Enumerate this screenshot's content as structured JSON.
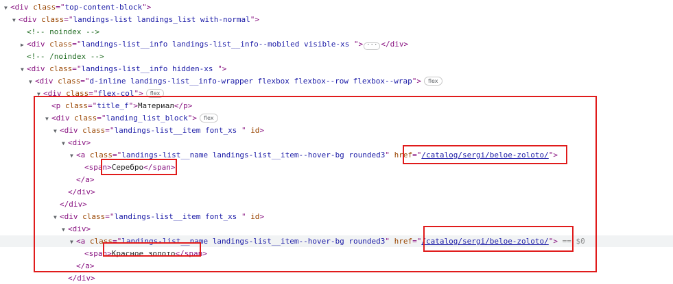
{
  "colors": {
    "tag": "#881280",
    "attr_name": "#994500",
    "attr_value": "#1a1aa6",
    "comment": "#236e25",
    "highlight": "#e01b1b"
  },
  "lines": [
    {
      "tri": "open",
      "parts": [
        {
          "t": "tag",
          "v": "<div "
        },
        {
          "t": "an",
          "v": "class"
        },
        {
          "t": "tag",
          "v": "=\""
        },
        {
          "t": "av",
          "v": "top-content-block"
        },
        {
          "t": "tag",
          "v": "\">"
        }
      ]
    },
    {
      "tri": "open",
      "parts": [
        {
          "t": "tag",
          "v": "<div "
        },
        {
          "t": "an",
          "v": "class"
        },
        {
          "t": "tag",
          "v": "=\""
        },
        {
          "t": "av",
          "v": "landings-list landings_list with-normal"
        },
        {
          "t": "tag",
          "v": "\">"
        }
      ]
    },
    {
      "tri": "none",
      "parts": [
        {
          "t": "cm",
          "v": "<!-- noindex -->"
        }
      ]
    },
    {
      "tri": "closed",
      "parts": [
        {
          "t": "tag",
          "v": "<div "
        },
        {
          "t": "an",
          "v": "class"
        },
        {
          "t": "tag",
          "v": "=\""
        },
        {
          "t": "av",
          "v": "landings-list__info landings-list__info--mobiled visible-xs "
        },
        {
          "t": "tag",
          "v": "\">"
        },
        {
          "t": "ell",
          "v": "···"
        },
        {
          "t": "tag",
          "v": "</div>"
        }
      ]
    },
    {
      "tri": "none",
      "parts": [
        {
          "t": "cm",
          "v": "<!-- /noindex -->"
        }
      ]
    },
    {
      "tri": "open",
      "parts": [
        {
          "t": "tag",
          "v": "<div "
        },
        {
          "t": "an",
          "v": "class"
        },
        {
          "t": "tag",
          "v": "=\""
        },
        {
          "t": "av",
          "v": "landings-list__info hidden-xs "
        },
        {
          "t": "tag",
          "v": "\">"
        }
      ]
    },
    {
      "tri": "open",
      "parts": [
        {
          "t": "tag",
          "v": "<div "
        },
        {
          "t": "an",
          "v": "class"
        },
        {
          "t": "tag",
          "v": "=\""
        },
        {
          "t": "av",
          "v": "d-inline landings-list__info-wrapper  flexbox flexbox--row flexbox--wrap"
        },
        {
          "t": "tag",
          "v": "\">"
        },
        {
          "t": "pill",
          "v": "flex"
        }
      ]
    },
    {
      "tri": "open",
      "parts": [
        {
          "t": "tag",
          "v": "<div "
        },
        {
          "t": "an",
          "v": "class"
        },
        {
          "t": "tag",
          "v": "=\""
        },
        {
          "t": "av",
          "v": "flex-col"
        },
        {
          "t": "tag",
          "v": "\">"
        },
        {
          "t": "pill",
          "v": "flex"
        }
      ]
    },
    {
      "tri": "none",
      "parts": [
        {
          "t": "tag",
          "v": "<p "
        },
        {
          "t": "an",
          "v": "class"
        },
        {
          "t": "tag",
          "v": "=\""
        },
        {
          "t": "av",
          "v": "title_f"
        },
        {
          "t": "tag",
          "v": "\">"
        },
        {
          "t": "txt",
          "v": "Материал"
        },
        {
          "t": "tag",
          "v": "</p>"
        }
      ]
    },
    {
      "tri": "open",
      "parts": [
        {
          "t": "tag",
          "v": "<div "
        },
        {
          "t": "an",
          "v": "class"
        },
        {
          "t": "tag",
          "v": "=\""
        },
        {
          "t": "av",
          "v": "landing_list_block"
        },
        {
          "t": "tag",
          "v": "\">"
        },
        {
          "t": "pill",
          "v": "flex"
        }
      ]
    },
    {
      "tri": "open",
      "parts": [
        {
          "t": "tag",
          "v": "<div "
        },
        {
          "t": "an",
          "v": "class"
        },
        {
          "t": "tag",
          "v": "=\""
        },
        {
          "t": "av",
          "v": "landings-list__item font_xs  "
        },
        {
          "t": "tag",
          "v": "\" "
        },
        {
          "t": "an",
          "v": "id"
        },
        {
          "t": "tag",
          "v": ">"
        }
      ]
    },
    {
      "tri": "open",
      "parts": [
        {
          "t": "tag",
          "v": "<div>"
        }
      ]
    },
    {
      "tri": "open",
      "parts": [
        {
          "t": "tag",
          "v": "<a "
        },
        {
          "t": "an",
          "v": "class"
        },
        {
          "t": "tag",
          "v": "=\""
        },
        {
          "t": "av",
          "v": "landings-list__name landings-list__item--hover-bg rounded3"
        },
        {
          "t": "tag",
          "v": "\" "
        },
        {
          "t": "an",
          "v": "href"
        },
        {
          "t": "tag",
          "v": "=\""
        },
        {
          "t": "avl",
          "v": "/catalog/sergi/beloe-zoloto/"
        },
        {
          "t": "tag",
          "v": "\">"
        }
      ]
    },
    {
      "tri": "none",
      "parts": [
        {
          "t": "tag",
          "v": "<span>"
        },
        {
          "t": "txt",
          "v": "Серебро"
        },
        {
          "t": "tag",
          "v": "</span>"
        }
      ]
    },
    {
      "tri": "none",
      "parts": [
        {
          "t": "tag",
          "v": "</a>"
        }
      ]
    },
    {
      "tri": "none",
      "parts": [
        {
          "t": "tag",
          "v": "</div>"
        }
      ]
    },
    {
      "tri": "none",
      "parts": [
        {
          "t": "tag",
          "v": "</div>"
        }
      ]
    },
    {
      "tri": "open",
      "parts": [
        {
          "t": "tag",
          "v": "<div "
        },
        {
          "t": "an",
          "v": "class"
        },
        {
          "t": "tag",
          "v": "=\""
        },
        {
          "t": "av",
          "v": "landings-list__item font_xs  "
        },
        {
          "t": "tag",
          "v": "\" "
        },
        {
          "t": "an",
          "v": "id"
        },
        {
          "t": "tag",
          "v": ">"
        }
      ]
    },
    {
      "tri": "open",
      "parts": [
        {
          "t": "tag",
          "v": "<div>"
        }
      ]
    },
    {
      "tri": "open",
      "parts": [
        {
          "t": "tag",
          "v": "<a "
        },
        {
          "t": "an",
          "v": "class"
        },
        {
          "t": "tag",
          "v": "=\""
        },
        {
          "t": "av",
          "v": "landings-list__name landings-list__item--hover-bg rounded3"
        },
        {
          "t": "tag",
          "v": "\" "
        },
        {
          "t": "an",
          "v": "href"
        },
        {
          "t": "tag",
          "v": "=\""
        },
        {
          "t": "avl",
          "v": "/catalog/sergi/beloe-zoloto/"
        },
        {
          "t": "tag",
          "v": "\">"
        },
        {
          "t": "mk",
          "v": " == $0"
        }
      ]
    },
    {
      "tri": "none",
      "parts": [
        {
          "t": "tag",
          "v": "<span>"
        },
        {
          "t": "txt",
          "v": "Красное золото"
        },
        {
          "t": "tag",
          "v": "</span>"
        }
      ]
    },
    {
      "tri": "none",
      "parts": [
        {
          "t": "tag",
          "v": "</a>"
        }
      ]
    },
    {
      "tri": "none",
      "parts": [
        {
          "t": "tag",
          "v": "</div>"
        }
      ]
    }
  ]
}
